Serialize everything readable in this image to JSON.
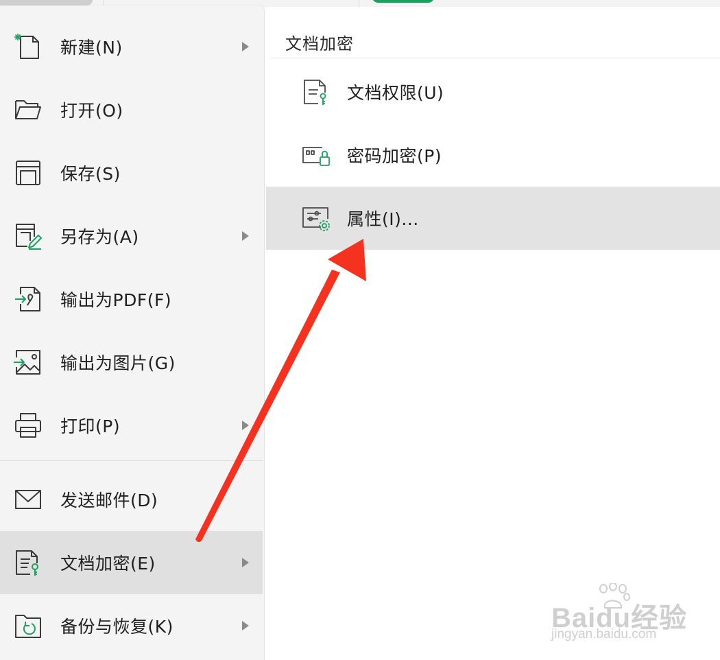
{
  "left_menu": {
    "items": [
      {
        "label": "新建(N)",
        "icon": "new-file-icon",
        "submenu": true
      },
      {
        "label": "打开(O)",
        "icon": "folder-open-icon",
        "submenu": false
      },
      {
        "label": "保存(S)",
        "icon": "save-icon",
        "submenu": false
      },
      {
        "label": "另存为(A)",
        "icon": "save-as-icon",
        "submenu": true
      },
      {
        "label": "输出为PDF(F)",
        "icon": "export-pdf-icon",
        "submenu": false
      },
      {
        "label": "输出为图片(G)",
        "icon": "export-image-icon",
        "submenu": false
      },
      {
        "label": "打印(P)",
        "icon": "printer-icon",
        "submenu": true
      },
      {
        "label": "发送邮件(D)",
        "icon": "mail-icon",
        "submenu": false
      },
      {
        "label": "文档加密(E)",
        "icon": "document-encrypt-icon",
        "submenu": true,
        "active": true
      },
      {
        "label": "备份与恢复(K)",
        "icon": "backup-restore-icon",
        "submenu": true
      }
    ]
  },
  "submenu": {
    "title": "文档加密",
    "items": [
      {
        "label": "文档权限(U)",
        "icon": "document-permission-icon"
      },
      {
        "label": "密码加密(P)",
        "icon": "password-lock-icon"
      },
      {
        "label": "属性(I)...",
        "icon": "properties-settings-icon",
        "hover": true
      }
    ]
  },
  "annotation": {
    "color": "#f5321f"
  },
  "watermark": {
    "main": "Baidu经验",
    "sub": "jingyan.baidu.com"
  },
  "colors": {
    "accent_green": "#1aa061",
    "menu_bg": "#f4f4f4",
    "active_bg": "#e0e0e0"
  }
}
